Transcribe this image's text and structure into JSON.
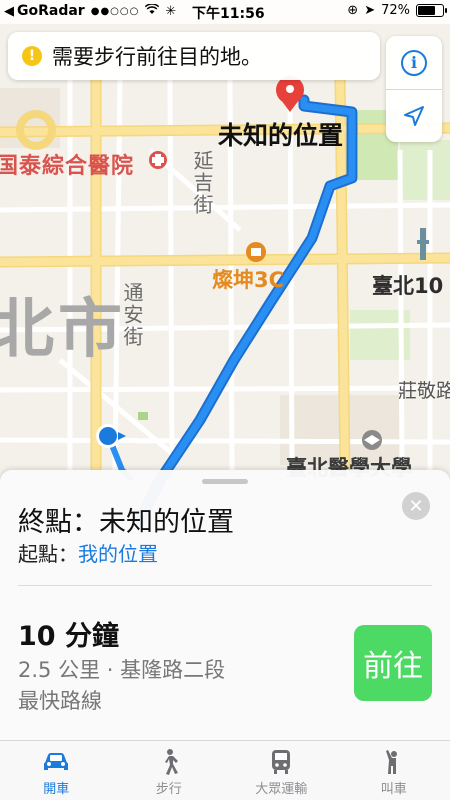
{
  "status_bar": {
    "back_icon": "back-arrow-icon",
    "carrier": "GoRadar",
    "signal_dots": "●●○○○",
    "wifi_icon": "wifi-icon",
    "activity_icon": "activity-spinner-icon",
    "time": "下午11:56",
    "lock_icon": "rotation-lock-icon",
    "location_icon": "location-arrow-icon",
    "battery_percent": "72%",
    "battery_level": 0.72
  },
  "banner": {
    "icon": "warning-icon",
    "icon_glyph": "!",
    "text": "需要步行前往目的地。"
  },
  "map_controls": {
    "info_glyph": "i",
    "info_icon": "info-icon",
    "location_icon": "location-arrow-icon"
  },
  "map": {
    "labels": {
      "hospital": "国泰綜合醫院",
      "yanji": "延吉街",
      "tongan": "通安街",
      "city": "北市",
      "canshen": "燦坤3C",
      "taipei_n": "臺北10",
      "zhuang": "莊敬路",
      "univ": "臺北醫學大學",
      "unknown_location": "未知的位置"
    },
    "colors": {
      "route": "#2a8ff2",
      "route_outline": "#1c6fd1",
      "main_road": "#fbe39a",
      "street": "#ffffff",
      "park": "#cfe8b4",
      "pin": "#e8403a"
    }
  },
  "card": {
    "destination_title": "終點：未知的位置",
    "origin_prefix": "起點：",
    "origin_value": "我的位置",
    "close_glyph": "✕",
    "eta_time": "10 分鐘",
    "eta_detail": "2.5 公里 · 基隆路二段",
    "eta_route": "最快路線",
    "go_label": "前往"
  },
  "tabbar": {
    "tabs": [
      {
        "label": "開車",
        "icon": "car-icon",
        "active": true
      },
      {
        "label": "步行",
        "icon": "walking-person-icon",
        "active": false
      },
      {
        "label": "大眾運輸",
        "icon": "bus-icon",
        "active": false
      },
      {
        "label": "叫車",
        "icon": "ride-hail-icon",
        "active": false
      }
    ],
    "active_color": "#1a7bdc",
    "inactive_color": "#8e8e93"
  }
}
